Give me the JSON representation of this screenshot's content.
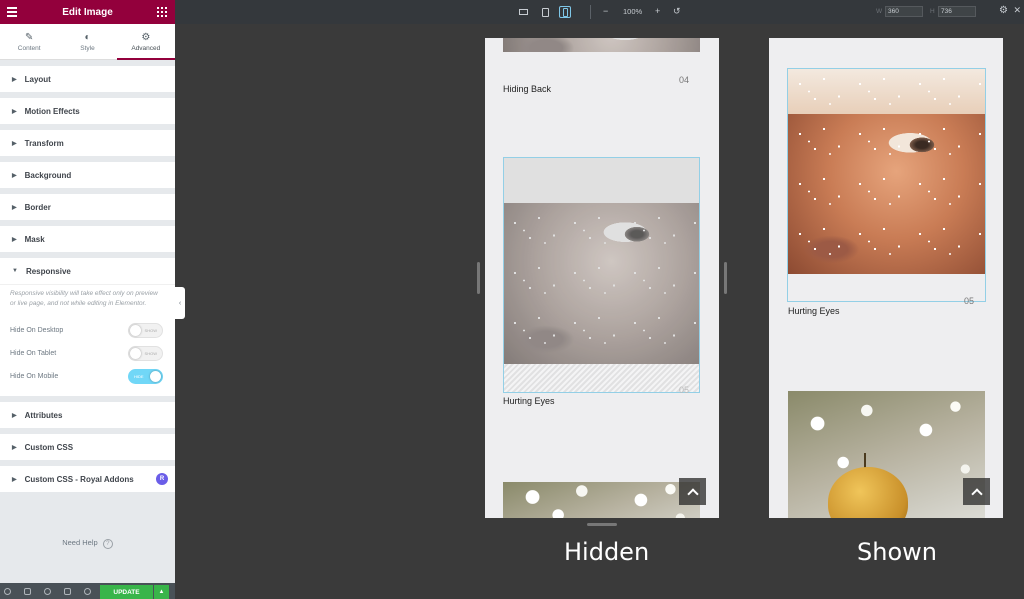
{
  "panel": {
    "title": "Edit Image",
    "tabs": [
      {
        "label": "Content",
        "icon": "pencil-icon"
      },
      {
        "label": "Style",
        "icon": "contrast-icon"
      },
      {
        "label": "Advanced",
        "icon": "gear-icon",
        "active": true
      }
    ],
    "sections": {
      "layout": "Layout",
      "motion": "Motion Effects",
      "transform": "Transform",
      "background": "Background",
      "border": "Border",
      "mask": "Mask",
      "responsive": "Responsive",
      "attributes": "Attributes",
      "custom_css": "Custom CSS",
      "custom_css_royal": "Custom CSS - Royal Addons"
    },
    "responsive": {
      "note": "Responsive visibility will take effect only on preview or live page, and not while editing in Elementor.",
      "toggles": [
        {
          "label": "Hide On Desktop",
          "state": "SHOW",
          "on": false
        },
        {
          "label": "Hide On Tablet",
          "state": "SHOW",
          "on": false
        },
        {
          "label": "Hide On Mobile",
          "state": "HIDE",
          "on": true
        }
      ]
    },
    "royal_badge": "R",
    "need_help": "Need Help",
    "help_icon": "?",
    "update_label": "UPDATE",
    "update_arrow": "▲",
    "accent": "#93003c",
    "update_color": "#39b54a"
  },
  "toolbar": {
    "zoom": "100%",
    "minus": "−",
    "plus": "+",
    "undo": "↺",
    "width_label": "W",
    "width_value": "360",
    "height_label": "H",
    "height_value": "736",
    "gear": "⚙",
    "close": "✕"
  },
  "preview_hidden": {
    "item1_title": "Hiding Back",
    "item1_num": "04",
    "item2_title": "Hurting Eyes",
    "item2_num": "05",
    "caption": "Hidden"
  },
  "preview_shown": {
    "item_title": "Hurting Eyes",
    "item_num": "05",
    "caption": "Shown"
  }
}
